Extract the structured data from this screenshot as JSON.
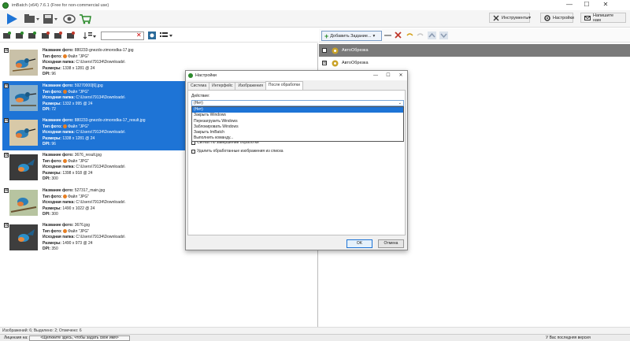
{
  "window": {
    "title": "imBatch (x64) 7.6.1 (Free for non-commercial use)",
    "controls": [
      "—",
      "☐",
      "✕"
    ]
  },
  "toolbar": {
    "tools_label": "Инструменты",
    "settings_label": "Настройки",
    "contact_label": "Напишите нам"
  },
  "images": [
    {
      "checked": "☒",
      "selected": false,
      "name_label": "Название фото:",
      "name": "880233-gnezdo-zimorodka-17.jpg",
      "type_label": "Тип фото:",
      "type": "Файл \"JPG\"",
      "folder_label": "Исходная папка:",
      "folder": "C:\\Users\\79134\\Downloads\\",
      "size_label": "Размеры:",
      "size": "1338 x 1281 @ 24",
      "dpi_label": "DPI:",
      "dpi": "96"
    },
    {
      "checked": "☒",
      "selected": true,
      "name_label": "Название фото:",
      "name": "59270000[6].jpg",
      "type_label": "Тип фото:",
      "type": "Файл \"JPG\"",
      "folder_label": "Исходная папка:",
      "folder": "C:\\Users\\79134\\Downloads\\",
      "size_label": "Размеры:",
      "size": "1332 x 995 @ 24",
      "dpi_label": "DPI:",
      "dpi": "72"
    },
    {
      "checked": "☒",
      "selected": true,
      "name_label": "Название фото:",
      "name": "880233-gnezdo-zimorodka-17_result.jpg",
      "type_label": "Тип фото:",
      "type": "Файл \"JPG\"",
      "folder_label": "Исходная папка:",
      "folder": "C:\\Users\\79134\\Downloads\\",
      "size_label": "Размеры:",
      "size": "1338 x 1281 @ 24",
      "dpi_label": "DPI:",
      "dpi": "96"
    },
    {
      "checked": "☒",
      "selected": false,
      "name_label": "Название фото:",
      "name": "3676_result.jpg",
      "type_label": "Тип фото:",
      "type": "Файл \"JPG\"",
      "folder_label": "Исходная папка:",
      "folder": "C:\\Users\\79134\\Downloads\\",
      "size_label": "Размеры:",
      "size": "1398 x 918 @ 24",
      "dpi_label": "DPI:",
      "dpi": "300"
    },
    {
      "checked": "☒",
      "selected": false,
      "name_label": "Название фото:",
      "name": "527317_main.jpg",
      "type_label": "Тип фото:",
      "type": "Файл \"JPG\"",
      "folder_label": "Исходная папка:",
      "folder": "C:\\Users\\79134\\Downloads\\",
      "size_label": "Размеры:",
      "size": "1490 x 1022 @ 24",
      "dpi_label": "DPI:",
      "dpi": "300"
    },
    {
      "checked": "☒",
      "selected": false,
      "name_label": "Название фото:",
      "name": "3676.jpg",
      "type_label": "Тип фото:",
      "type": "Файл \"JPG\"",
      "folder_label": "Исходная папка:",
      "folder": "C:\\Users\\79134\\Downloads\\",
      "size_label": "Размеры:",
      "size": "1490 x 973 @ 24",
      "dpi_label": "DPI:",
      "dpi": "350"
    }
  ],
  "tasks_toolbar": {
    "add_task_label": "Добавить Задание..."
  },
  "tasks": [
    {
      "label": "АвтоОбрезка"
    },
    {
      "label": "АвтоОбрезка"
    }
  ],
  "status": {
    "text": "Изображений: 6; Выделено: 2; Отмечено: 6",
    "license_label": "Лицензия на:",
    "license_button": "<Щелкните здесь, чтобы задать свое имя>",
    "version_text": "У Вас последняя версия"
  },
  "dialog": {
    "title": "Настройки",
    "tabs": [
      "Система",
      "Интерфейс",
      "Изображения",
      "После обработки"
    ],
    "active_tab": 3,
    "action_label": "Действие:",
    "combo_value": "(Нет)",
    "options": [
      "(Нет)",
      "Закрыть Windows",
      "Перезагрузить Windows",
      "Заблокировать Windows",
      "Закрыть ImBatch",
      "Выполнить команду..."
    ],
    "checkbox1": "Сигнал по завершении обработки",
    "checkbox2": "Удалить обработанные изображения из списка",
    "ok_label": "OK",
    "cancel_label": "Отмена"
  },
  "colors": {
    "selection": "#1e74d6",
    "accent_green": "#2a8a2a"
  }
}
